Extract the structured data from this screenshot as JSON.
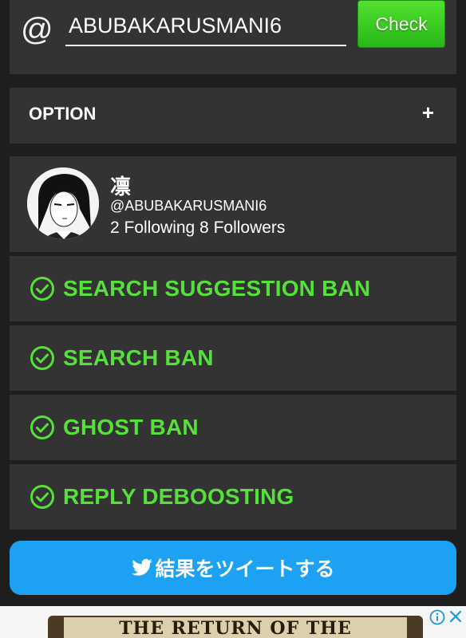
{
  "search": {
    "at_symbol": "@",
    "username_value": "ABUBAKARUSMANI6",
    "check_label": "Check"
  },
  "option": {
    "label": "OPTION",
    "expand_symbol": "+"
  },
  "profile": {
    "display_name": "凛",
    "handle": "@ABUBAKARUSMANI6",
    "following_followers": "2 Following 8 Followers"
  },
  "status_checks": [
    {
      "label": "SEARCH SUGGESTION BAN",
      "icon": "check-circle-icon",
      "status": "ok"
    },
    {
      "label": "SEARCH BAN",
      "icon": "check-circle-icon",
      "status": "ok"
    },
    {
      "label": "GHOST BAN",
      "icon": "check-circle-icon",
      "status": "ok"
    },
    {
      "label": "REPLY DEBOOSTING",
      "icon": "check-circle-icon",
      "status": "ok"
    }
  ],
  "tweet_button": {
    "label": "結果をツイートする",
    "icon": "twitter-bird-icon"
  },
  "ad": {
    "text": "THE RETURN OF THE"
  },
  "colors": {
    "page_background": "#1e1e1e",
    "card_background": "#333333",
    "status_green": "#55e03a",
    "check_button_green": "#3fcf25",
    "tweet_blue": "#1da1f2"
  }
}
